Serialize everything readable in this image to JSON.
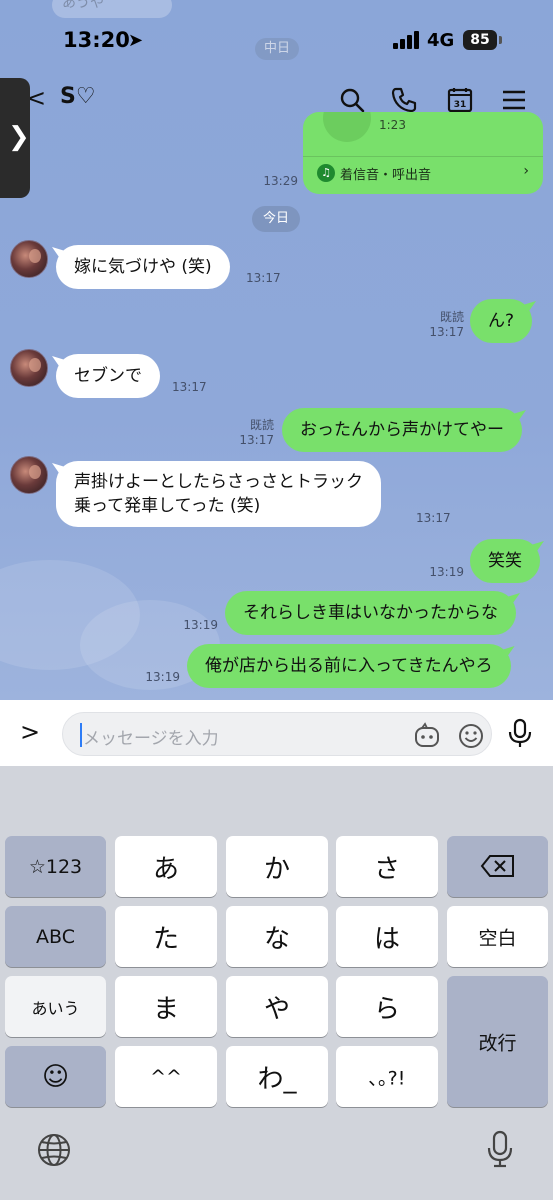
{
  "status": {
    "time": "13:20",
    "network": "4G",
    "battery": "85"
  },
  "header": {
    "back_symbol": "<",
    "title": "S♡",
    "ghost_top": "あうや",
    "ghost_date": "中日",
    "side_tab_symbol": "❯"
  },
  "media_card": {
    "duration": "1:23",
    "ringtone_label": "着信音・呼出音",
    "chevron": "›"
  },
  "messages": {
    "m0_time": "13:29",
    "date_separator": "今日",
    "m1_text": "嫁に気づけや (笑)",
    "m1_time": "13:17",
    "m2_read": "既読",
    "m2_time": "13:17",
    "m2_text": "ん?",
    "m3_text": "セブンで",
    "m3_time": "13:17",
    "m4_read": "既読",
    "m4_time": "13:17",
    "m4_text": "おったんから声かけてやー",
    "m5_line1": "声掛けよーとしたらさっさとトラック",
    "m5_line2": "乗って発車してった (笑)",
    "m5_time": "13:17",
    "m6_time": "13:19",
    "m6_text": "笑笑",
    "m7_time": "13:19",
    "m7_text": "それらしき車はいなかったからな",
    "m8_time": "13:19",
    "m8_text": "俺が店から出る前に入ってきたんやろ"
  },
  "input": {
    "expand_symbol": ">",
    "placeholder": "メッセージを入力"
  },
  "keyboard": {
    "r1": [
      "☆123",
      "あ",
      "か",
      "さ"
    ],
    "r2": [
      "ABC",
      "た",
      "な",
      "は",
      "空白"
    ],
    "r3": [
      "あいう",
      "ま",
      "や",
      "ら",
      "改行"
    ],
    "r4": [
      "☺",
      "^^",
      "わ_",
      "､｡?!"
    ]
  },
  "colors": {
    "chat_bg": "#8ba6d8",
    "outgoing_bubble": "#79e06b",
    "incoming_bubble": "#ffffff",
    "keyboard_bg": "#d1d4db"
  }
}
